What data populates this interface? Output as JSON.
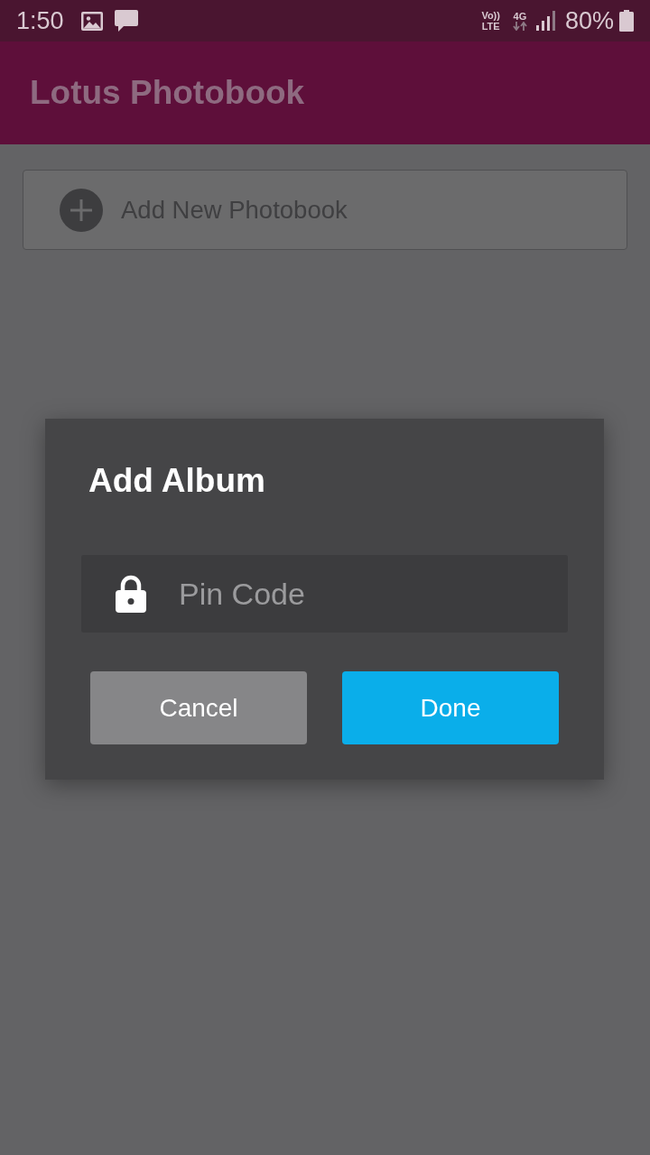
{
  "status_bar": {
    "time": "1:50",
    "volte_top": "Vo))",
    "volte_bottom": "LTE",
    "network": "4G",
    "battery": "80%"
  },
  "app_bar": {
    "title": "Lotus Photobook"
  },
  "add_card": {
    "label": "Add New Photobook"
  },
  "dialog": {
    "title": "Add Album",
    "pin_field": {
      "placeholder": "Pin Code"
    },
    "buttons": [
      {
        "label": "Cancel",
        "kind": "secondary"
      },
      {
        "label": "Done",
        "kind": "primary"
      }
    ]
  }
}
